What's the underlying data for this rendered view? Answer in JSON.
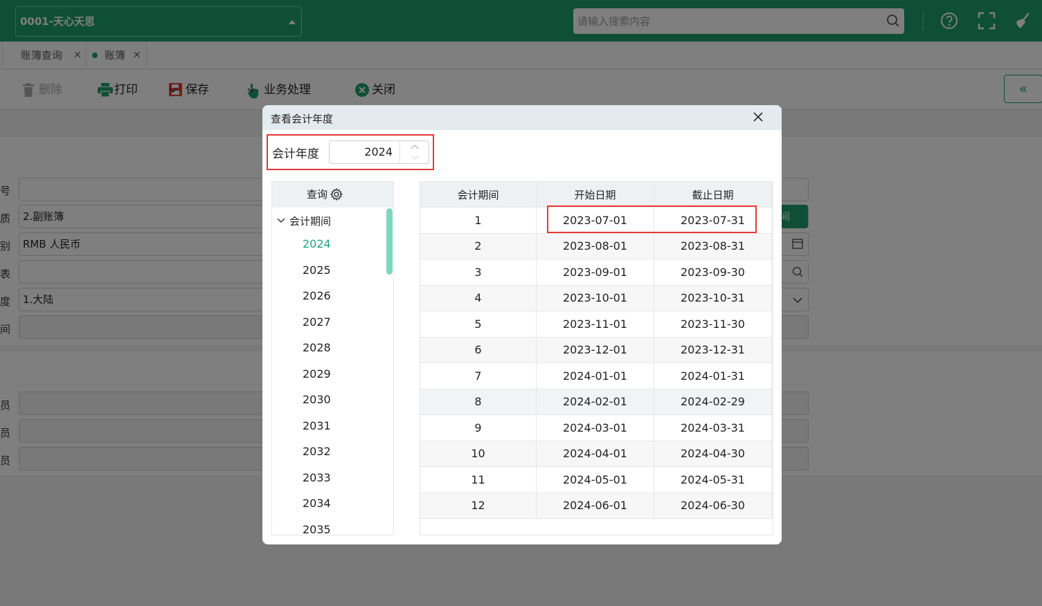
{
  "header": {
    "org": "0001-天心天思",
    "search_placeholder": "请输入搜索内容",
    "icons": [
      "help-icon",
      "fullscreen-icon",
      "broom-icon"
    ]
  },
  "tabs": [
    {
      "label": "账簿查询",
      "active": false
    },
    {
      "label": "账簿",
      "active": true
    }
  ],
  "toolbar": {
    "delete": "删除",
    "print": "打印",
    "save": "保存",
    "business": "业务处理",
    "close": "关闭",
    "collapse": "«"
  },
  "form": {
    "labels": [
      "号",
      "质",
      "别",
      "表",
      "度",
      "间",
      "员",
      "员",
      "员"
    ],
    "type_value": "2.副账簿",
    "currency_value": "RMB  人民币",
    "region_value": "1.大陆",
    "side_button": "间"
  },
  "dialog": {
    "title": "查看会计年度",
    "year_label": "会计年度",
    "year_value": "2024",
    "tree_header": "查询",
    "tree_root": "会计期间",
    "selected_year": "2024",
    "years": [
      "2024",
      "2025",
      "2026",
      "2027",
      "2028",
      "2029",
      "2030",
      "2031",
      "2032",
      "2033",
      "2034",
      "2035"
    ],
    "columns": [
      "会计期间",
      "开始日期",
      "截止日期"
    ],
    "rows": [
      [
        "1",
        "2023-07-01",
        "2023-07-31"
      ],
      [
        "2",
        "2023-08-01",
        "2023-08-31"
      ],
      [
        "3",
        "2023-09-01",
        "2023-09-30"
      ],
      [
        "4",
        "2023-10-01",
        "2023-10-31"
      ],
      [
        "5",
        "2023-11-01",
        "2023-11-30"
      ],
      [
        "6",
        "2023-12-01",
        "2023-12-31"
      ],
      [
        "7",
        "2024-01-01",
        "2024-01-31"
      ],
      [
        "8",
        "2024-02-01",
        "2024-02-29"
      ],
      [
        "9",
        "2024-03-01",
        "2024-03-31"
      ],
      [
        "10",
        "2024-04-01",
        "2024-04-30"
      ],
      [
        "11",
        "2024-05-01",
        "2024-05-31"
      ],
      [
        "12",
        "2024-06-01",
        "2024-06-30"
      ]
    ],
    "highlight_color": "#e53935"
  },
  "colors": {
    "brand": "#1e9e6e",
    "tree_selected": "#1ea47a"
  }
}
